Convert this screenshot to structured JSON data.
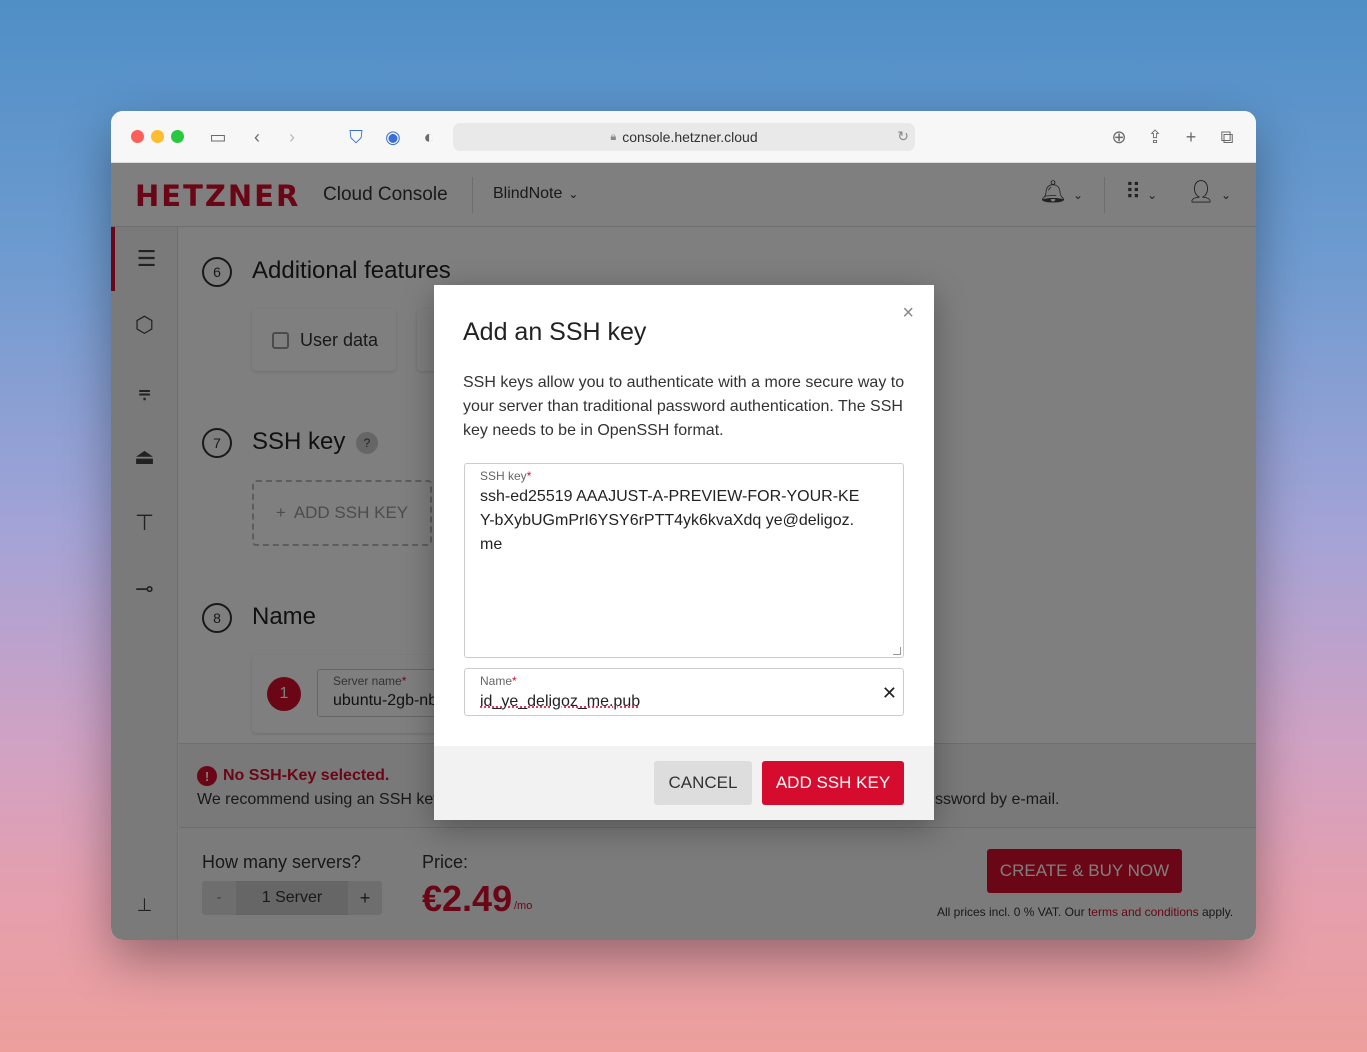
{
  "browser": {
    "url": "console.hetzner.cloud"
  },
  "header": {
    "logo": "HETZNER",
    "title": "Cloud Console",
    "project": "BlindNote"
  },
  "steps": {
    "s6": {
      "num": "6",
      "title": "Additional features",
      "user_data": "User data"
    },
    "s7": {
      "num": "7",
      "title": "SSH key",
      "help": "?",
      "add_button": "ADD SSH KEY"
    },
    "s8": {
      "num": "8",
      "title": "Name",
      "server_index": "1",
      "server_name_label": "Server name",
      "server_name_value": "ubuntu-2gb-nbg1-1"
    }
  },
  "warning": {
    "title": "No SSH-Key selected.",
    "text": "We recommend using an SSH key",
    "text_tail": "ssword by e-mail."
  },
  "footer": {
    "how_many": "How many servers?",
    "minus": "-",
    "count": "1 Server",
    "plus": "+",
    "price_label": "Price:",
    "price": "€2.49",
    "per": "/mo",
    "create": "CREATE & BUY NOW",
    "vat_prefix": "All prices incl. 0 % VAT. Our ",
    "terms": "terms and conditions",
    "vat_suffix": " apply."
  },
  "modal": {
    "title": "Add an SSH key",
    "description": "SSH keys allow you to authenticate with a more secure way to your server than traditional password authentication. The SSH key needs to be in OpenSSH format.",
    "ssh_key_label": "SSH key",
    "ssh_key_value": "ssh-ed25519 AAAJUST-A-PREVIEW-FOR-YOUR-KEY-bXybUGmPrI6YSY6rPTT4yk6kvaXdq ye@deligoz.me",
    "name_label": "Name",
    "name_value": "id_ye_deligoz_me.pub",
    "cancel": "CANCEL",
    "add": "ADD SSH KEY",
    "required_mark": "*"
  },
  "colors": {
    "brand": "#d50c2d"
  }
}
